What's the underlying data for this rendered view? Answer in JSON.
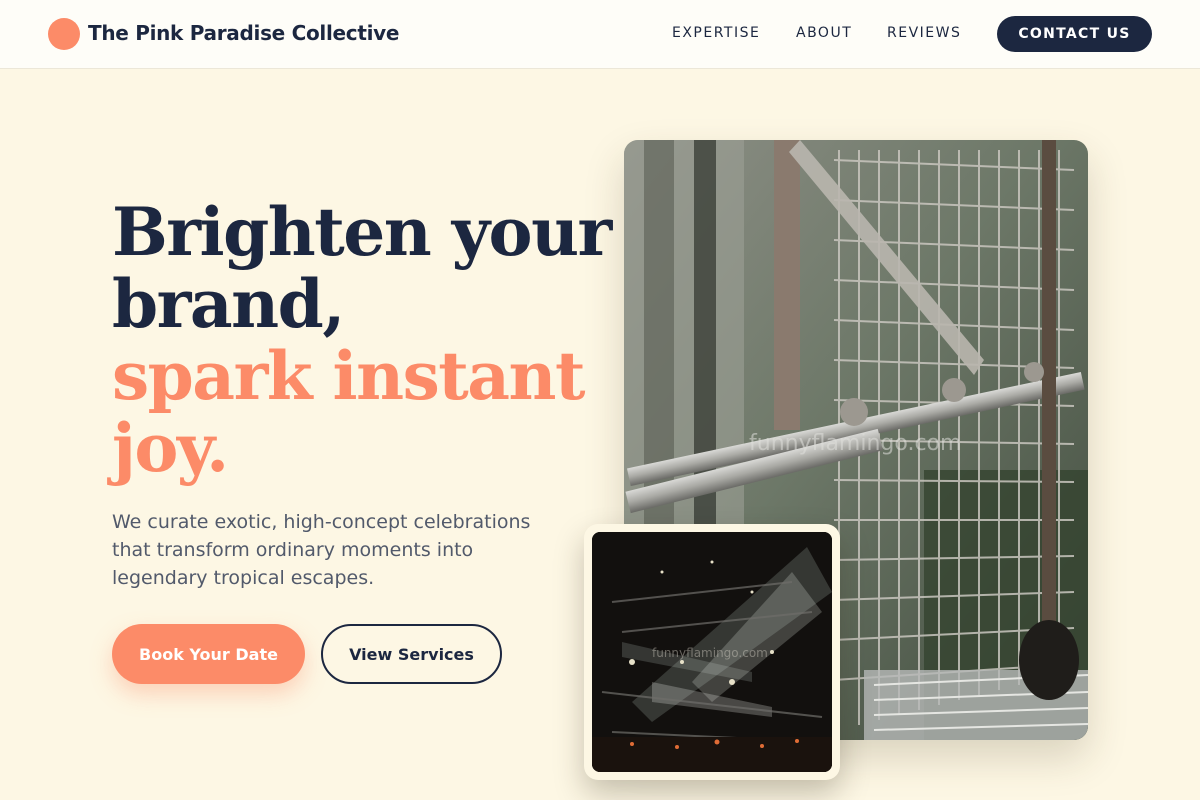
{
  "header": {
    "brand": "The Pink Paradise Collective",
    "nav": [
      "EXPERTISE",
      "ABOUT",
      "REVIEWS"
    ],
    "contact_label": "CONTACT US"
  },
  "hero": {
    "headline_line1": "Brighten your",
    "headline_line2": "brand,",
    "headline_accent1": "spark instant",
    "headline_accent2": "joy.",
    "subtitle": "We curate exotic, high-concept celebrations that transform ordinary moments into legendary tropical escapes.",
    "primary_button": "Book Your Date",
    "secondary_button": "View Services"
  },
  "media": {
    "main_watermark": "funnyflamingo.com",
    "inset_watermark": "funnyflamingo.com"
  },
  "colors": {
    "accent": "#fc8b68",
    "navy": "#1c2740",
    "background": "#fdf7e4"
  }
}
